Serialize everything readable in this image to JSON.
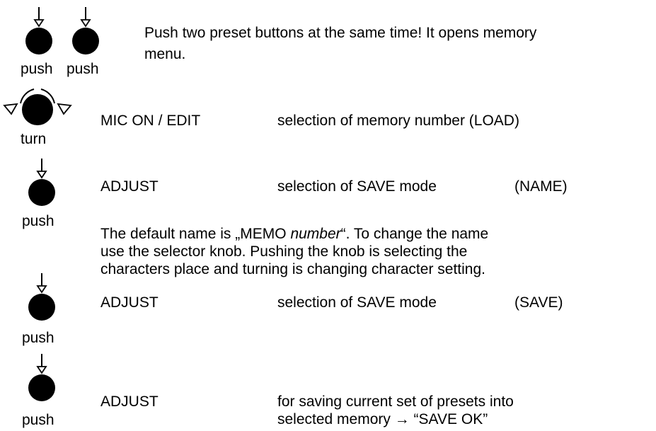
{
  "intro": {
    "push_label_1": "push",
    "push_label_2": "push",
    "text_line_1": "Push two preset buttons at the same time! It opens memory",
    "text_line_2": "menu."
  },
  "steps": [
    {
      "icon": "turn-knob-icon",
      "icon_label": "turn",
      "control": "MIC ON / EDIT",
      "action": "selection of memory number (LOAD)",
      "mode": ""
    },
    {
      "icon": "push-knob-icon",
      "icon_label": "push",
      "control": "ADJUST",
      "action": "selection of SAVE mode",
      "mode": "(NAME)"
    },
    {
      "icon": "push-knob-icon",
      "icon_label": "push",
      "control": "ADJUST",
      "action": "selection of SAVE mode",
      "mode": "(SAVE)"
    },
    {
      "icon": "push-knob-icon",
      "icon_label": "push",
      "control": "ADJUST",
      "action_line_1": "for saving current set of presets into",
      "action_line_2": "selected memory → “SAVE OK”"
    }
  ],
  "note": {
    "prefix": "The default name is „MEMO ",
    "italic": "number",
    "suffix": "“. To change the name",
    "line_2": "use the selector knob. Pushing the knob is selecting the",
    "line_3": "characters place and turning is changing character setting."
  }
}
